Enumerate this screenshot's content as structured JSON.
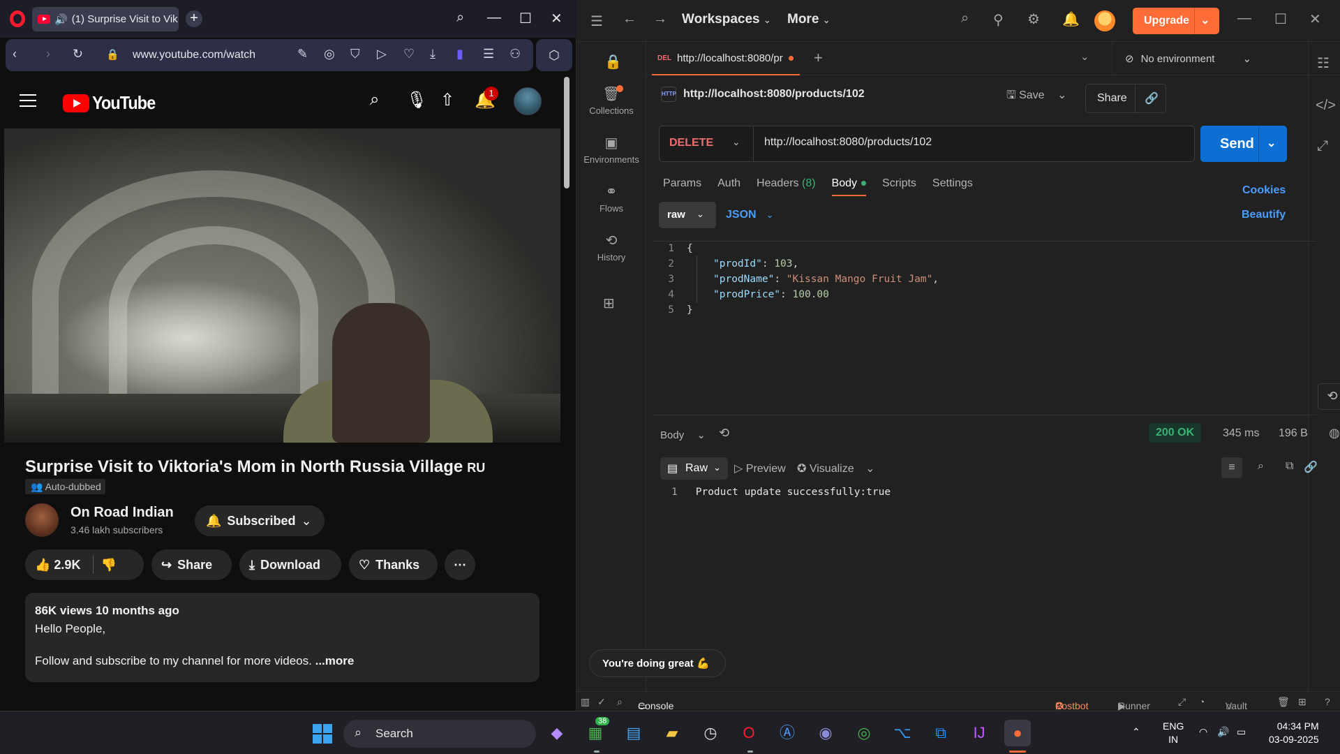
{
  "opera": {
    "tab_title": "(1) Surprise Visit to Vik",
    "url": "www.youtube.com/watch",
    "colors": {
      "brand": "#ff1b2d",
      "addressbar": "#2c2f45"
    }
  },
  "youtube": {
    "logo_text": "YouTube",
    "notification_count": "1",
    "video_title": "Surprise Visit to Viktoria's Mom in North Russia Village",
    "video_title_tag": "RU",
    "auto_dubbed": "Auto-dubbed",
    "channel_name": "On Road Indian",
    "channel_subs": "3.46 lakh subscribers",
    "subscribed_label": "Subscribed",
    "likes": "2.9K",
    "share_label": "Share",
    "download_label": "Download",
    "thanks_label": "Thanks",
    "views_time": "86K views  10 months ago",
    "desc_line1": "Hello People,",
    "desc_line2": "Follow and subscribe to my channel for more videos.",
    "more_label": "...more"
  },
  "postman": {
    "menu_workspaces": "Workspaces",
    "menu_more": "More",
    "upgrade_label": "Upgrade",
    "sidebar": [
      {
        "label": "Collections",
        "icon": "collections-icon"
      },
      {
        "label": "Environments",
        "icon": "environments-icon"
      },
      {
        "label": "Flows",
        "icon": "flows-icon"
      },
      {
        "label": "History",
        "icon": "history-icon"
      }
    ],
    "tab_method": "DEL",
    "tab_title": "http://localhost:8080/pr",
    "environment": "No environment",
    "request_name": "http://localhost:8080/products/102",
    "save_label": "Save",
    "share_label": "Share",
    "method": "DELETE",
    "url": "http://localhost:8080/products/102",
    "send_label": "Send",
    "req_tabs": {
      "params": "Params",
      "auth": "Auth",
      "headers": "Headers",
      "headers_count": "(8)",
      "body": "Body",
      "scripts": "Scripts",
      "settings": "Settings"
    },
    "cookies_label": "Cookies",
    "beautify_label": "Beautify",
    "body_mode": "raw",
    "body_format": "JSON",
    "code_lines": [
      "1",
      "2",
      "3",
      "4",
      "5"
    ],
    "body_json": {
      "open": "{",
      "prodId_key": "\"prodId\"",
      "prodId_val": "103",
      "prodName_key": "\"prodName\"",
      "prodName_val": "\"Kissan Mango Fruit Jam\"",
      "prodPrice_key": "\"prodPrice\"",
      "prodPrice_val": "100.00",
      "close": "}"
    },
    "response": {
      "body_label": "Body",
      "status": "200 OK",
      "time": "345 ms",
      "size": "196 B",
      "view_raw": "Raw",
      "view_preview": "Preview",
      "view_visualize": "Visualize",
      "line": "1",
      "text": "Product update successfully:true"
    },
    "toast": "You're doing great",
    "bottom": {
      "console": "Console",
      "postbot": "Postbot",
      "runner": "Runner",
      "vault": "Vault"
    },
    "colors": {
      "accent": "#ff6c37",
      "send": "#0e6fd3",
      "delete": "#f06e6e",
      "ok": "#3bb273",
      "link": "#4a9eff"
    }
  },
  "taskbar": {
    "search_label": "Search",
    "badge_count": "38",
    "lang_line1": "ENG",
    "lang_line2": "IN",
    "time": "04:34 PM",
    "date": "03-09-2025"
  }
}
